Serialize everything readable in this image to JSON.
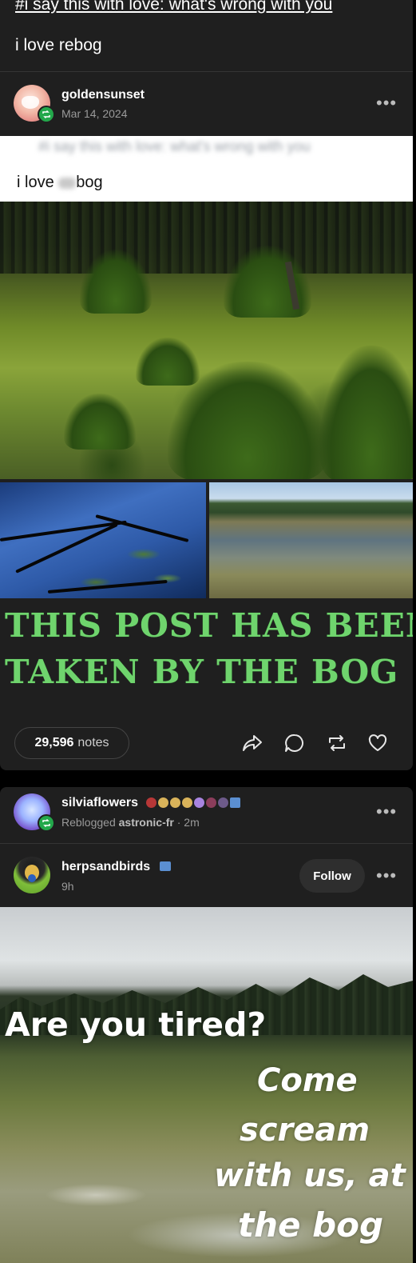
{
  "post1": {
    "tag_line": "#i say this with love: what's wrong with you",
    "top_text": "i love rebog",
    "author": "goldensunset",
    "date": "Mar 14, 2024",
    "more": "•••",
    "blurred_tags": "#i say this with love: what's wrong with you",
    "quote_prefix": "i love ",
    "quote_suffix": "bog",
    "bog_title_line1": "THIS POST HAS BEEN",
    "bog_title_line2": "TAKEN BY THE BOG",
    "notes_count": "29,596",
    "notes_label": "notes",
    "icons": [
      "share-icon",
      "comment-icon",
      "reblog-icon",
      "heart-icon"
    ]
  },
  "post2": {
    "reblogger": "silviaflowers",
    "reblogged_label": "Reblogged",
    "reblogged_from": "astronic-fr",
    "reblog_time": "· 2m",
    "more": "•••",
    "author": "herpsandbirds",
    "time": "9h",
    "follow_label": "Follow",
    "meme_line1": "Are you tired?",
    "meme_line2": "Come",
    "meme_line3": "scream",
    "meme_line4": "with us, at",
    "meme_line5": "the bog"
  },
  "colors": {
    "background": "#000000",
    "card": "#1f1f1f",
    "reblog_green": "#23a84b",
    "bog_green": "#6fd46d"
  }
}
